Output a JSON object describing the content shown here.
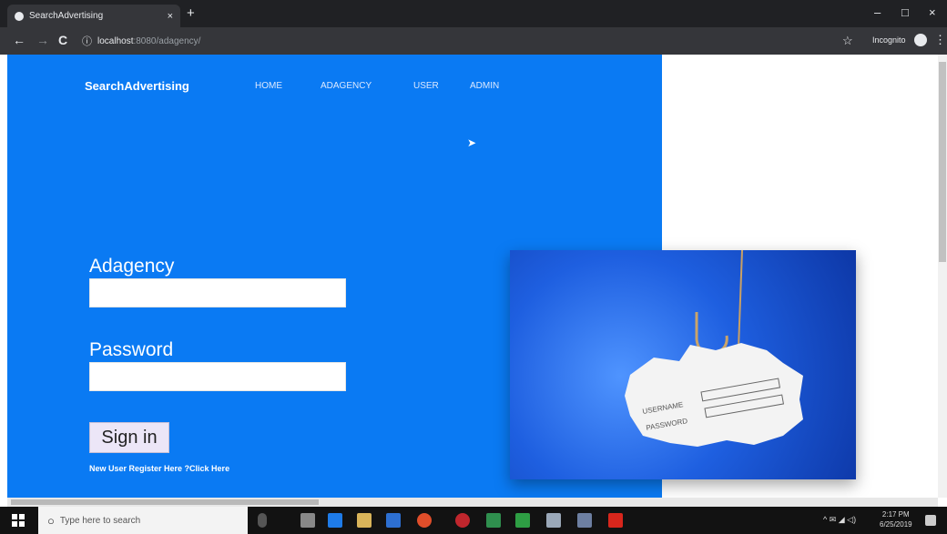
{
  "browser": {
    "tab_title": "SearchAdvertising",
    "tab_close": "×",
    "new_tab": "+",
    "window_controls": [
      "–",
      "□",
      "×"
    ],
    "nav_buttons": [
      "←",
      "→",
      "C"
    ],
    "url_host": "localhost",
    "url_path": ":8080/adagency/",
    "incognito_label": "Incognito",
    "menu_glyph": "⋮",
    "star_glyph": "☆"
  },
  "site": {
    "brand": "SearchAdvertising",
    "nav": [
      "HOME",
      "ADAGENCY",
      "USER",
      "ADMIN"
    ]
  },
  "login": {
    "username_label": "Adagency",
    "password_label": "Password",
    "username_value": "",
    "password_value": "",
    "signin_label": "Sign in",
    "register_text": "New User Register Here ?Click Here"
  },
  "hero_image": {
    "username_text": "USERNAME",
    "password_text": "PASSWORD"
  },
  "taskbar": {
    "search_placeholder": "Type here to search",
    "time": "2:17 PM",
    "date": "6/25/2019",
    "tray_icons": "^ ✉ ◢ ◁)"
  },
  "colors": {
    "page_blue": "#0a7af3",
    "chrome_dark": "#202124",
    "taskbar": "#121212"
  }
}
